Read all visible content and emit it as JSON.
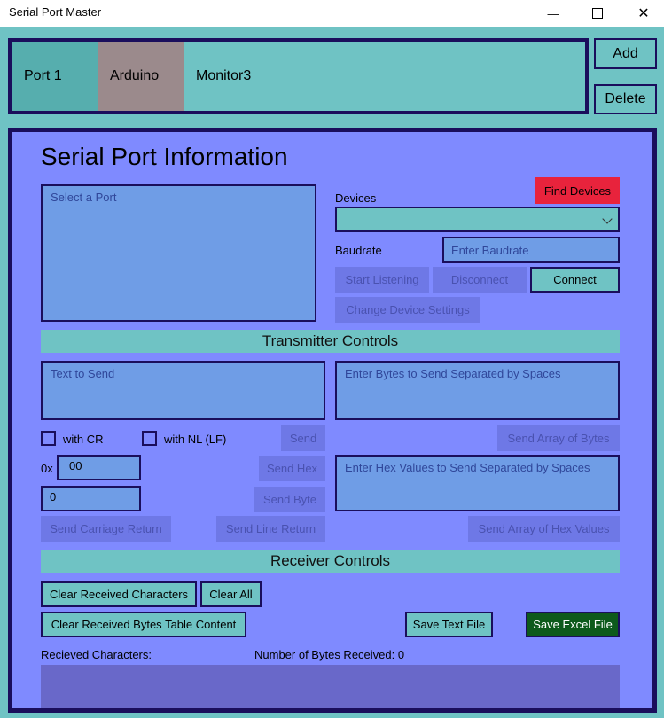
{
  "window": {
    "title": "Serial Port Master",
    "minimize_glyph": "—",
    "maximize_glyph": "☐",
    "close_glyph": "✕"
  },
  "tabs": [
    {
      "label": "Port 1",
      "color": "#56aeae"
    },
    {
      "label": "Arduino",
      "color": "#9b8a8c"
    },
    {
      "label": "Monitor3",
      "color": "#6fc3c4"
    }
  ],
  "side_buttons": {
    "add": "Add",
    "delete": "Delete"
  },
  "info": {
    "heading": "Serial Port Information",
    "port_list_placeholder": "Select a Port",
    "devices_label": "Devices",
    "find_devices": "Find Devices",
    "devices_value": "",
    "chevron": "⌵",
    "baudrate_label": "Baudrate",
    "baudrate_placeholder": "Enter Baudrate",
    "start_listening": "Start Listening",
    "disconnect": "Disconnect",
    "connect": "Connect",
    "change_settings": "Change Device Settings"
  },
  "transmitter": {
    "heading": "Transmitter Controls",
    "text_to_send_placeholder": "Text to Send",
    "bytes_placeholder": "Enter Bytes to Send Separated by Spaces",
    "with_cr": "with CR",
    "with_nl": "with NL (LF)",
    "send": "Send",
    "send_array_bytes": "Send Array of Bytes",
    "hex_prefix": "0x",
    "hex_value": "00",
    "send_hex": "Send Hex",
    "hex_values_placeholder": "Enter Hex Values to Send Separated by Spaces",
    "byte_value": "0",
    "send_byte": "Send Byte",
    "send_cr": "Send Carriage Return",
    "send_lf": "Send Line Return",
    "send_array_hex": "Send Array of Hex Values"
  },
  "receiver": {
    "heading": "Receiver Controls",
    "clear_chars": "Clear Received Characters",
    "clear_all": "Clear All",
    "clear_table": "Clear Received Bytes Table Content",
    "save_text": "Save Text File",
    "save_excel": "Save Excel File",
    "received_chars_label": "Recieved Characters:",
    "bytes_received_label": "Number of Bytes Received: 0"
  },
  "colors": {
    "accent_dark": "#1a0e5c",
    "teal": "#6fc3c4",
    "panel": "#7f8aff",
    "find_devices_red": "#e8233c",
    "excel_green": "#0d5a1b"
  }
}
